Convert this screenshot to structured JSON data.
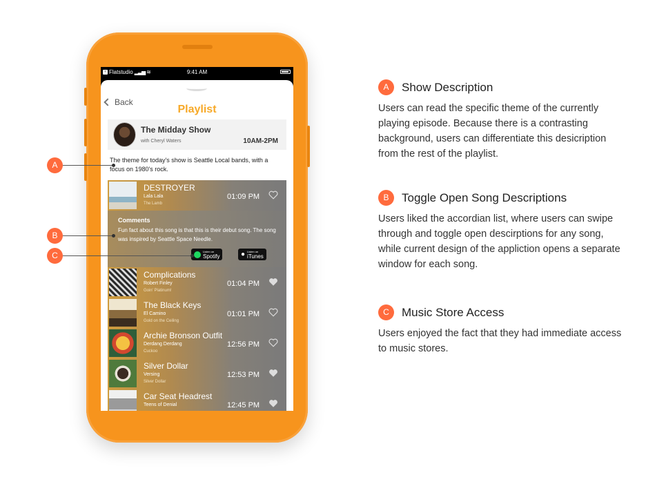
{
  "colors": {
    "phone": "#f7941d",
    "accent": "#f7a928",
    "marker": "#ff6b3d"
  },
  "status_bar": {
    "carrier": "Flatstudio",
    "time": "9:41 AM"
  },
  "header": {
    "back_label": "Back",
    "title": "Playlist"
  },
  "show": {
    "name": "The Midday Show",
    "host": "with Cheryl Waters",
    "time": "10AM-2PM",
    "description": "The theme for today's show is Seattle Local bands, with a focus on 1980's rock."
  },
  "songs": [
    {
      "title": "DESTROYER",
      "artist": "Lala Lala",
      "album": "The Lamb",
      "time": "01:09 PM",
      "liked": false
    },
    {
      "title": "Complications",
      "artist": "Robert Finley",
      "album": "Goin' Platinum!",
      "time": "01:04 PM",
      "liked": true
    },
    {
      "title": "The Black Keys",
      "artist": "El Camino",
      "album": "Gold on the Ceiling",
      "time": "01:01 PM",
      "liked": false
    },
    {
      "title": "Archie Bronson Outfit",
      "artist": "Derdang Derdang",
      "album": "Cuckoo",
      "time": "12:56 PM",
      "liked": false
    },
    {
      "title": "Silver Dollar",
      "artist": "Versing",
      "album": "Silver Dollar",
      "time": "12:53 PM",
      "liked": true
    },
    {
      "title": "Car Seat Headrest",
      "artist": "Teens of Denial",
      "album": "",
      "time": "12:45 PM",
      "liked": true
    }
  ],
  "comments": {
    "heading": "Comments",
    "text": "Fun fact about this song is that this is their debut song. The song was inspired by Seattle Space Needle."
  },
  "stores": {
    "spotify_small": "Listen on",
    "spotify_big": "Spotify",
    "itunes_small": "Listen on",
    "itunes_big": "iTunes"
  },
  "callouts": [
    {
      "letter": "A",
      "title": "Show Description",
      "text": "Users can read the specific theme of the currently playing episode. Because there is a contrasting background, users can differentiate this desicription from the rest of the playlist."
    },
    {
      "letter": "B",
      "title": "Toggle Open Song Descriptions",
      "text": "Users liked the accordian list, where users can swipe through and toggle open descirptions for any song, while current design of the appliction opens a separate window for each song."
    },
    {
      "letter": "C",
      "title": "Music Store Access",
      "text": "Users enjoyed the fact that they had immediate access to music stores."
    }
  ]
}
